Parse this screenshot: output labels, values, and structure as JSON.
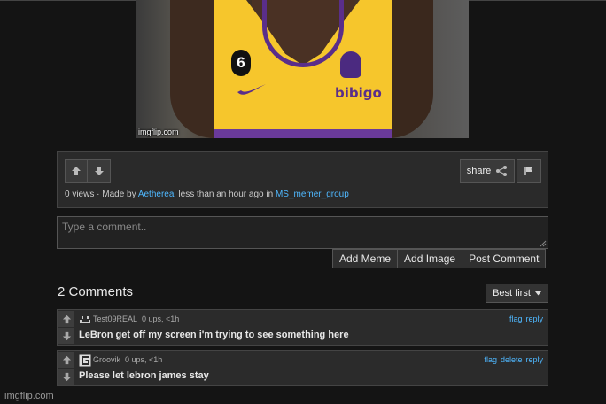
{
  "image": {
    "watermark": "imgflip.com",
    "jersey_number": "6",
    "sponsor": "bibigo"
  },
  "actions": {
    "share_label": "share",
    "meta": {
      "views": "0 views",
      "made_by_prefix": " · Made by ",
      "author": "Aethereal",
      "time_prefix": " less than an hour ago in ",
      "stream": "MS_memer_group"
    }
  },
  "comment_form": {
    "placeholder": "Type a comment..",
    "add_meme": "Add Meme",
    "add_image": "Add Image",
    "post_comment": "Post Comment"
  },
  "comments_header": {
    "count_label": "2 Comments",
    "sort_label": "Best first"
  },
  "comments": [
    {
      "user": "Test09REAL",
      "meta": "0 ups, <1h",
      "text": "LeBron get off my screen i'm trying to see something here",
      "actions": [
        "flag",
        "reply"
      ]
    },
    {
      "user": "Groovik",
      "meta": "0 ups, <1h",
      "text": "Please let lebron james stay",
      "actions": [
        "flag",
        "delete",
        "reply"
      ]
    }
  ],
  "footer": {
    "watermark": "imgflip.com"
  },
  "colors": {
    "link": "#4fb8ff",
    "background": "#141414",
    "panel": "#2a2a2a",
    "jersey": "#f6c62c"
  }
}
